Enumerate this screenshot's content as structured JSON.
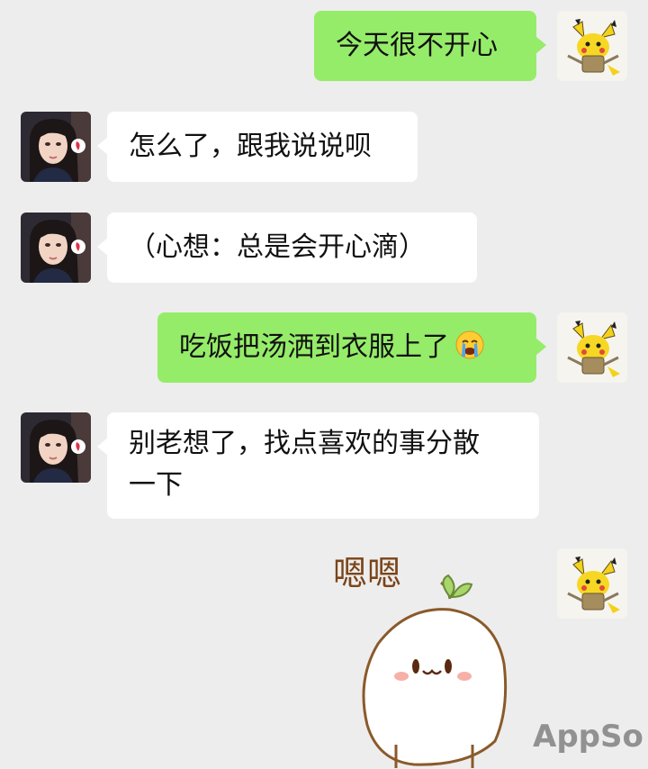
{
  "messages": [
    {
      "sender": "me",
      "text": "今天很不开心"
    },
    {
      "sender": "contact",
      "text": "怎么了，跟我说说呗"
    },
    {
      "sender": "contact",
      "text": "（心想：总是会开心滴）"
    },
    {
      "sender": "me",
      "text": "吃饭把汤洒到衣服上了",
      "emoji": "crying-face-icon"
    },
    {
      "sender": "contact",
      "text_line1": "别老想了，找点喜欢的事分散",
      "text_line2": "一下"
    },
    {
      "sender": "me",
      "sticker": {
        "caption": "嗯嗯"
      }
    }
  ],
  "watermark": "AppSo",
  "colors": {
    "background": "#ededed",
    "my_bubble": "#95ec69",
    "contact_bubble": "#ffffff",
    "text": "#111111",
    "watermark": "#8a8a8a"
  }
}
